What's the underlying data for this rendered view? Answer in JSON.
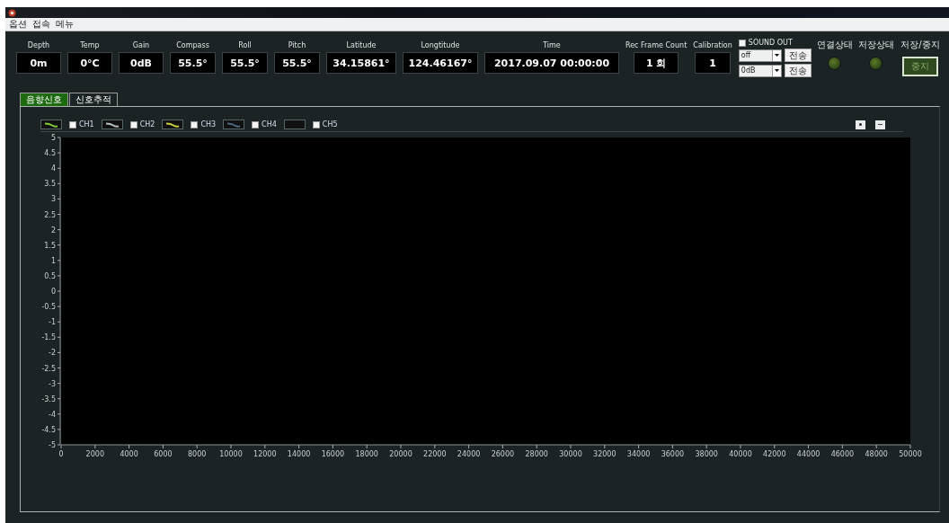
{
  "menu": [
    {
      "label": "옵션"
    },
    {
      "label": "접속"
    },
    {
      "label": "메뉴"
    }
  ],
  "readouts": [
    {
      "label": "Depth",
      "value": "0m"
    },
    {
      "label": "Temp",
      "value": "0°C"
    },
    {
      "label": "Gain",
      "value": "0dB"
    },
    {
      "label": "Compass",
      "value": "55.5°"
    },
    {
      "label": "Roll",
      "value": "55.5°"
    },
    {
      "label": "Pitch",
      "value": "55.5°"
    },
    {
      "label": "Latitude",
      "value": "34.15861°"
    },
    {
      "label": "Longtitude",
      "value": "124.46167°"
    },
    {
      "label": "Time",
      "value": "2017.09.07  00:00:00"
    },
    {
      "label": "Rec Frame Count",
      "value": "1 회"
    },
    {
      "label": "Calibration",
      "value": "1"
    }
  ],
  "sound_out": {
    "label": "SOUND OUT",
    "checked": false,
    "selects": [
      {
        "value": "off",
        "button": "전송"
      },
      {
        "value": "0dB",
        "button": "전송"
      }
    ]
  },
  "indicators": [
    {
      "label": "연결상태",
      "on": false
    },
    {
      "label": "저장상태",
      "on": false
    }
  ],
  "save_stop": {
    "label": "저장/중지",
    "button": "중지"
  },
  "tabs": [
    {
      "label": "음향신호",
      "selected": true
    },
    {
      "label": "신호추적",
      "selected": false
    }
  ],
  "channels": [
    {
      "label": "CH1",
      "checked": false,
      "color": "#7fc93a"
    },
    {
      "label": "CH2",
      "checked": false,
      "color": "#b8c0c0"
    },
    {
      "label": "CH3",
      "checked": false,
      "color": "#c8d040"
    },
    {
      "label": "CH4",
      "checked": false,
      "color": "#4a6a80"
    },
    {
      "label": "CH5",
      "checked": false
    }
  ],
  "chart_data": {
    "type": "line",
    "xlim": [
      0,
      50000
    ],
    "ylim": [
      -5,
      5
    ],
    "xticks": [
      0,
      2000,
      4000,
      6000,
      8000,
      10000,
      12000,
      14000,
      16000,
      18000,
      20000,
      22000,
      24000,
      26000,
      28000,
      30000,
      32000,
      34000,
      36000,
      38000,
      40000,
      42000,
      44000,
      46000,
      48000,
      50000
    ],
    "yticks": [
      5,
      4.5,
      4,
      3.5,
      3,
      2.5,
      2,
      1.5,
      1,
      0.5,
      0,
      -0.5,
      -1,
      -1.5,
      -2,
      -2.5,
      -3,
      -3.5,
      -4,
      -4.5,
      -5
    ]
  }
}
